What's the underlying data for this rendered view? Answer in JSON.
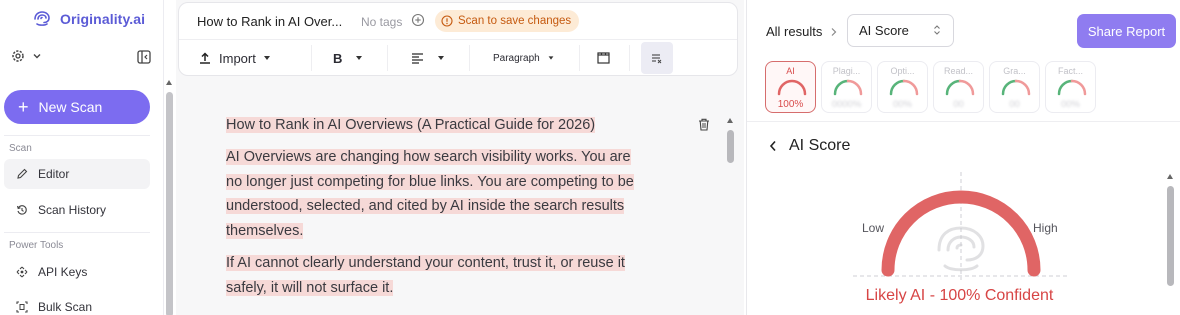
{
  "brand": {
    "name": "Originality.ai",
    "accent": "#5b5bd6"
  },
  "sidebar": {
    "new_scan_label": "New Scan",
    "sections": [
      {
        "title": "Scan",
        "items": [
          {
            "label": "Editor",
            "icon": "pencil-icon",
            "active": true
          },
          {
            "label": "Scan History",
            "icon": "history-icon"
          }
        ]
      },
      {
        "title": "Power Tools",
        "items": [
          {
            "label": "API Keys",
            "icon": "api-icon"
          },
          {
            "label": "Bulk Scan",
            "icon": "bulk-scan-icon"
          }
        ]
      }
    ]
  },
  "editor": {
    "doc_title": "How to Rank in AI Over...",
    "no_tags": "No tags",
    "save_notice": "Scan to save changes",
    "toolbar": {
      "import": "Import",
      "bold": "B",
      "paragraph": "Paragraph"
    },
    "content": {
      "title": "How to Rank in AI Overviews (A Practical Guide for 2026)",
      "paragraphs": [
        "AI Overviews are changing how search visibility works. You are no longer just competing for blue links. You are competing to be understood, selected, and cited by AI inside the search results themselves.",
        "If AI cannot clearly understand your content, trust it, or reuse it safely, it will not surface it."
      ]
    },
    "highlight_color": "#f6d9d7"
  },
  "results": {
    "all_results": "All results",
    "selected_view": "AI Score",
    "share_label": "Share Report",
    "chips": [
      {
        "label": "AI",
        "value": "100%",
        "active": true
      },
      {
        "label": "Plagi...",
        "value": "0000%"
      },
      {
        "label": "Opti...",
        "value": "00%"
      },
      {
        "label": "Read...",
        "value": "00"
      },
      {
        "label": "Gra...",
        "value": "00"
      },
      {
        "label": "Fact...",
        "value": "00%"
      }
    ],
    "section_title": "AI Score",
    "gauge": {
      "low": "Low",
      "high": "High",
      "ai_fraction": 1.0,
      "color": "#e06565"
    },
    "verdict": "Likely AI - 100% Confident",
    "verdict_color": "#d74545"
  }
}
